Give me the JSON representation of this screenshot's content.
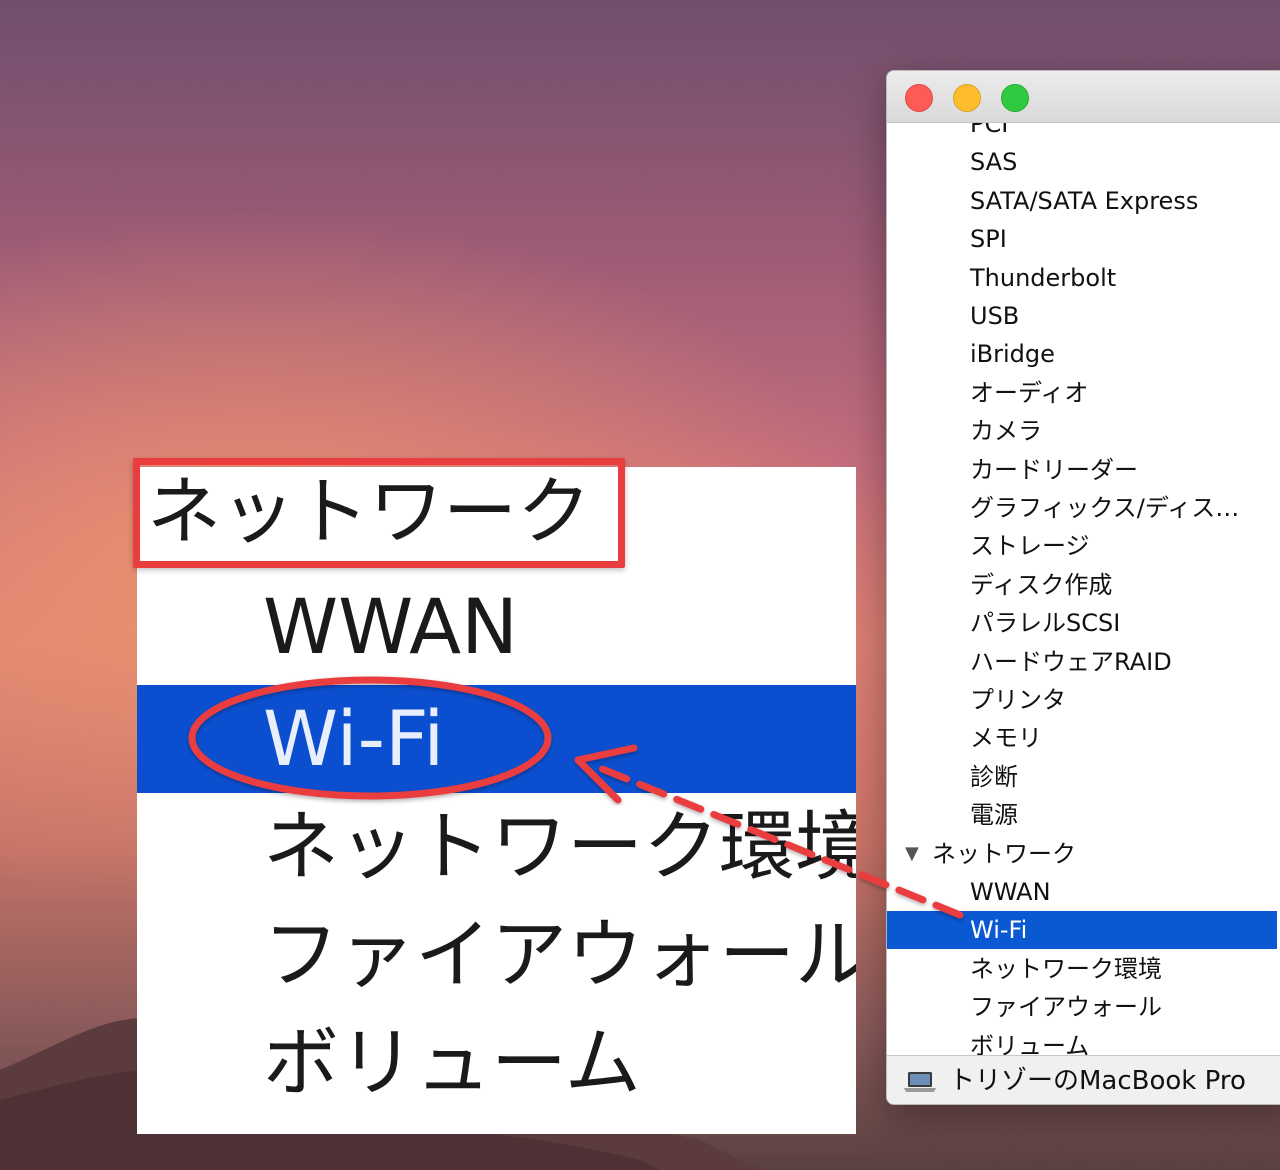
{
  "window": {
    "buttons": {
      "close": "close",
      "minimize": "minimize",
      "zoom": "zoom"
    },
    "tree_items": [
      {
        "label": "PCI",
        "type": "child"
      },
      {
        "label": "SAS",
        "type": "child"
      },
      {
        "label": "SATA/SATA Express",
        "type": "child"
      },
      {
        "label": "SPI",
        "type": "child"
      },
      {
        "label": "Thunderbolt",
        "type": "child"
      },
      {
        "label": "USB",
        "type": "child"
      },
      {
        "label": "iBridge",
        "type": "child"
      },
      {
        "label": "オーディオ",
        "type": "child"
      },
      {
        "label": "カメラ",
        "type": "child"
      },
      {
        "label": "カードリーダー",
        "type": "child"
      },
      {
        "label": "グラフィックス/ディス…",
        "type": "child"
      },
      {
        "label": "ストレージ",
        "type": "child"
      },
      {
        "label": "ディスク作成",
        "type": "child"
      },
      {
        "label": "パラレルSCSI",
        "type": "child"
      },
      {
        "label": "ハードウェアRAID",
        "type": "child"
      },
      {
        "label": "プリンタ",
        "type": "child"
      },
      {
        "label": "メモリ",
        "type": "child"
      },
      {
        "label": "診断",
        "type": "child"
      },
      {
        "label": "電源",
        "type": "child"
      },
      {
        "label": "ネットワーク",
        "type": "section",
        "disclosure": "▼"
      },
      {
        "label": "WWAN",
        "type": "child"
      },
      {
        "label": "Wi-Fi",
        "type": "child",
        "selected": true
      },
      {
        "label": "ネットワーク環境",
        "type": "child"
      },
      {
        "label": "ファイアウォール",
        "type": "child"
      },
      {
        "label": "ボリューム",
        "type": "child"
      }
    ],
    "status_bar": {
      "text": "トリゾーのMacBook Pro",
      "icon": "laptop-icon"
    }
  },
  "zoom_callout": {
    "heading": "ネットワーク",
    "items": [
      {
        "label": "WWAN"
      },
      {
        "label": "Wi-Fi",
        "selected": true
      },
      {
        "label": "ネットワーク環境"
      },
      {
        "label": "ファイアウォール"
      },
      {
        "label": "ボリューム"
      }
    ]
  },
  "colors": {
    "selection": "#0b58d3",
    "annotation": "#ea3d3f"
  }
}
